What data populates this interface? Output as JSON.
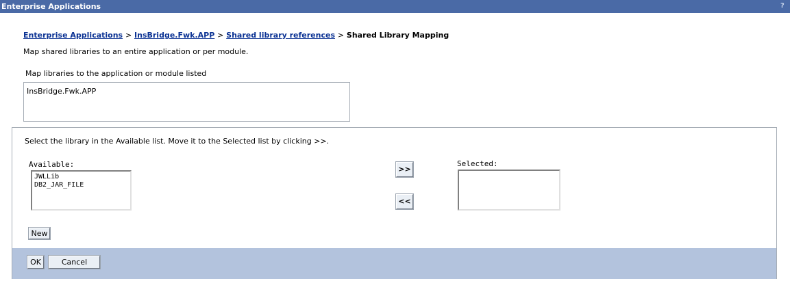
{
  "titlebar": {
    "title": "Enterprise Applications",
    "help_icon": "question-mark-icon",
    "help_glyph": "?"
  },
  "breadcrumb": {
    "items": [
      {
        "label": "Enterprise Applications",
        "link": true
      },
      {
        "label": "InsBridge.Fwk.APP",
        "link": true
      },
      {
        "label": "Shared library references",
        "link": true
      },
      {
        "label": "Shared Library Mapping",
        "link": false
      }
    ],
    "separator": ">"
  },
  "description": "Map shared libraries to an entire application or per module.",
  "mapping": {
    "label": "Map libraries to the application or module listed",
    "application": "InsBridge.Fwk.APP"
  },
  "library_panel": {
    "instruction": "Select the library in the Available list. Move it to the Selected list by clicking >>.",
    "available_label": "Available:",
    "available_items": [
      "JWLLib",
      "DB2_JAR_FILE"
    ],
    "selected_label": "Selected:",
    "selected_items": [],
    "add_button": ">>",
    "remove_button": "<<",
    "new_button": "New"
  },
  "footer": {
    "ok_button": "OK",
    "cancel_button": "Cancel"
  },
  "colors": {
    "titlebar_bg": "#4a6aa6",
    "link": "#0c3394",
    "footer_bg": "#b3c3dd",
    "border": "#a5acb5"
  }
}
